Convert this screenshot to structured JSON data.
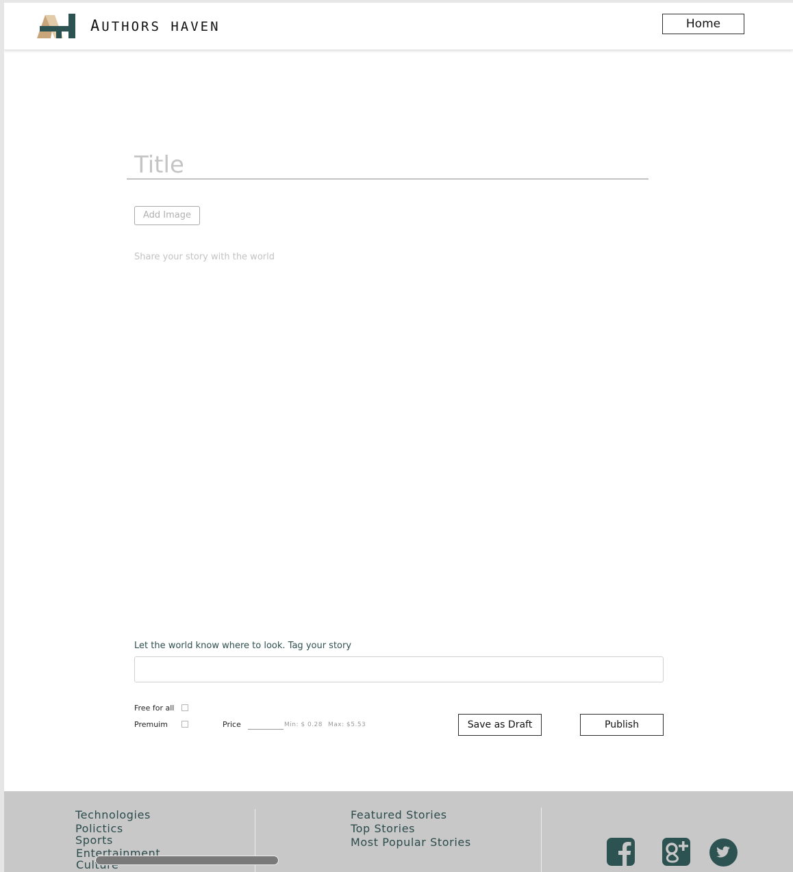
{
  "header": {
    "brand_first": "A",
    "brand_rest": "UTHORS HAVEN",
    "home_label": "Home"
  },
  "editor": {
    "title_placeholder": "Title",
    "add_image_label": "Add Image",
    "story_placeholder": "Share your story with the world",
    "tags_label": "Let the world know where to look. Tag your story"
  },
  "pricing": {
    "free_label": "Free for all",
    "premium_label": "Premuim",
    "price_label": "Price",
    "min_label": "Min: $ 0.28",
    "max_label": "Max: $5.53"
  },
  "actions": {
    "save_draft_label": "Save as Draft",
    "publish_label": "Publish"
  },
  "footer": {
    "categories": [
      "Technologies",
      "Polictics",
      "Sports",
      "Entertainment",
      "Culture"
    ],
    "stories": [
      "Featured Stories",
      "Top Stories",
      "Most Popular Stories"
    ],
    "social_icons": [
      "facebook-icon",
      "google-plus-icon",
      "twitter-icon"
    ]
  },
  "colors": {
    "brand_dark": "#2d5252",
    "brand_tan": "#c9a57a",
    "footer_bg": "#c8c8c8"
  }
}
